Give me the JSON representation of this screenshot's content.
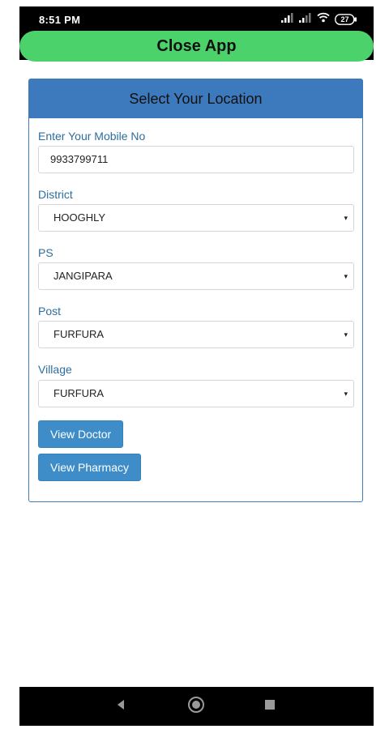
{
  "status_bar": {
    "time": "8:51 PM",
    "battery": "27",
    "icons": [
      "signal-icon",
      "signal-icon",
      "wifi-icon",
      "battery-icon"
    ]
  },
  "close_app": {
    "label": "Close App",
    "color": "#4cd26b"
  },
  "form": {
    "title": "Select Your Location",
    "accent_color": "#3c79bd",
    "mobile": {
      "label": "Enter Your Mobile No",
      "value": "9933799711"
    },
    "district": {
      "label": "District",
      "selected": "HOOGHLY"
    },
    "ps": {
      "label": "PS",
      "selected": "JANGIPARA"
    },
    "post": {
      "label": "Post",
      "selected": "FURFURA"
    },
    "village": {
      "label": "Village",
      "selected": "FURFURA"
    },
    "select_arrow": "▾"
  },
  "buttons": {
    "view_doctor": "View Doctor",
    "view_pharmacy": "View Pharmacy",
    "color": "#3e8dc9"
  },
  "nav": {
    "icons": [
      "back-icon",
      "home-icon",
      "recents-icon"
    ]
  }
}
